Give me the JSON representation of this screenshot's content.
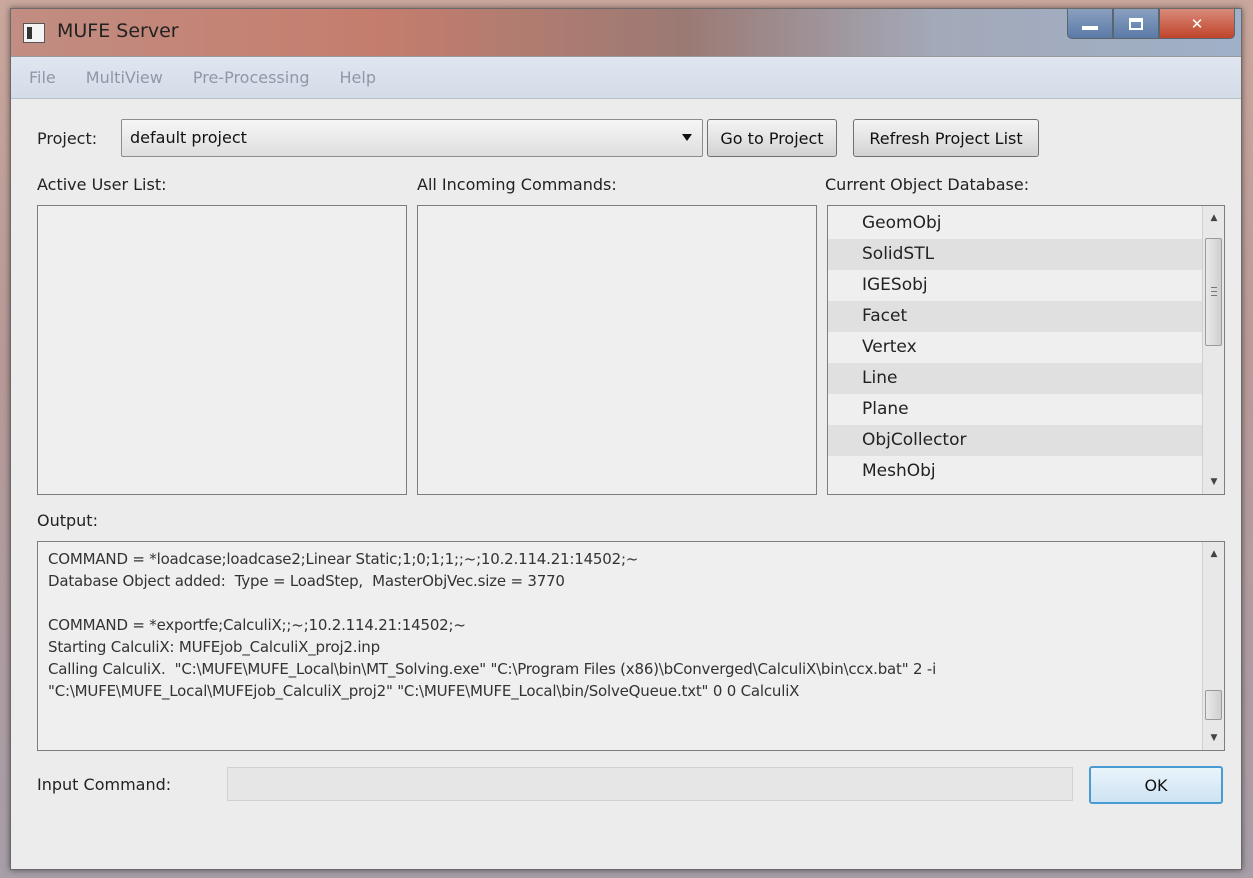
{
  "window": {
    "title": "MUFE Server"
  },
  "menu": {
    "items": [
      "File",
      "MultiView",
      "Pre-Processing",
      "Help"
    ]
  },
  "project": {
    "label": "Project:",
    "selected": "default project",
    "go_button": "Go to Project",
    "refresh_button": "Refresh Project List"
  },
  "panels": {
    "active_users_label": "Active User List:",
    "incoming_label": "All Incoming Commands:",
    "database_label": "Current Object Database:",
    "database_items": [
      "GeomObj",
      "SolidSTL",
      "IGESobj",
      "Facet",
      "Vertex",
      "Line",
      "Plane",
      "ObjCollector",
      "MeshObj"
    ]
  },
  "output": {
    "label": "Output:",
    "text": "COMMAND = *loadcase;loadcase2;Linear Static;1;0;1;1;;~;10.2.114.21:14502;~\nDatabase Object added:  Type = LoadStep,  MasterObjVec.size = 3770\n\nCOMMAND = *exportfe;CalculiX;;~;10.2.114.21:14502;~\nStarting CalculiX: MUFEjob_CalculiX_proj2.inp\nCalling CalculiX.  \"C:\\MUFE\\MUFE_Local\\bin\\MT_Solving.exe\" \"C:\\Program Files (x86)\\bConverged\\CalculiX\\bin\\ccx.bat\" 2 -i \"C:\\MUFE\\MUFE_Local\\MUFEjob_CalculiX_proj2\" \"C:\\MUFE\\MUFE_Local\\bin/SolveQueue.txt\" 0 0 CalculiX"
  },
  "input": {
    "label": "Input Command:",
    "value": "",
    "ok_button": "OK"
  }
}
